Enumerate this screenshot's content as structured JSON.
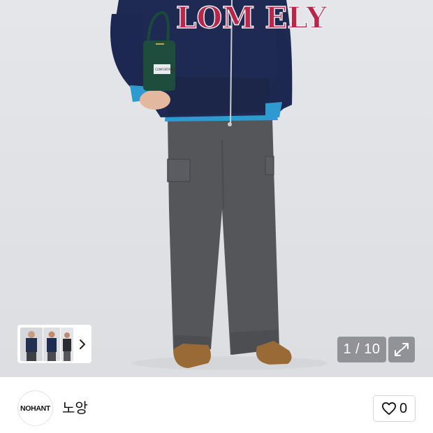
{
  "gallery": {
    "counter_text": "1 / 10",
    "hoodie_lettering": "LOM  ELY",
    "pouch_tag": "COMFORTABLE",
    "thumbnails": [
      {
        "name": "thumbnail-1"
      },
      {
        "name": "thumbnail-2"
      },
      {
        "name": "thumbnail-3"
      }
    ],
    "icons": {
      "next": "chevron-right-icon",
      "expand": "expand-icon"
    }
  },
  "brand": {
    "logo_text": "NOHANT",
    "name": "노앙"
  },
  "like": {
    "icon": "heart-outline-icon",
    "count": "0"
  }
}
